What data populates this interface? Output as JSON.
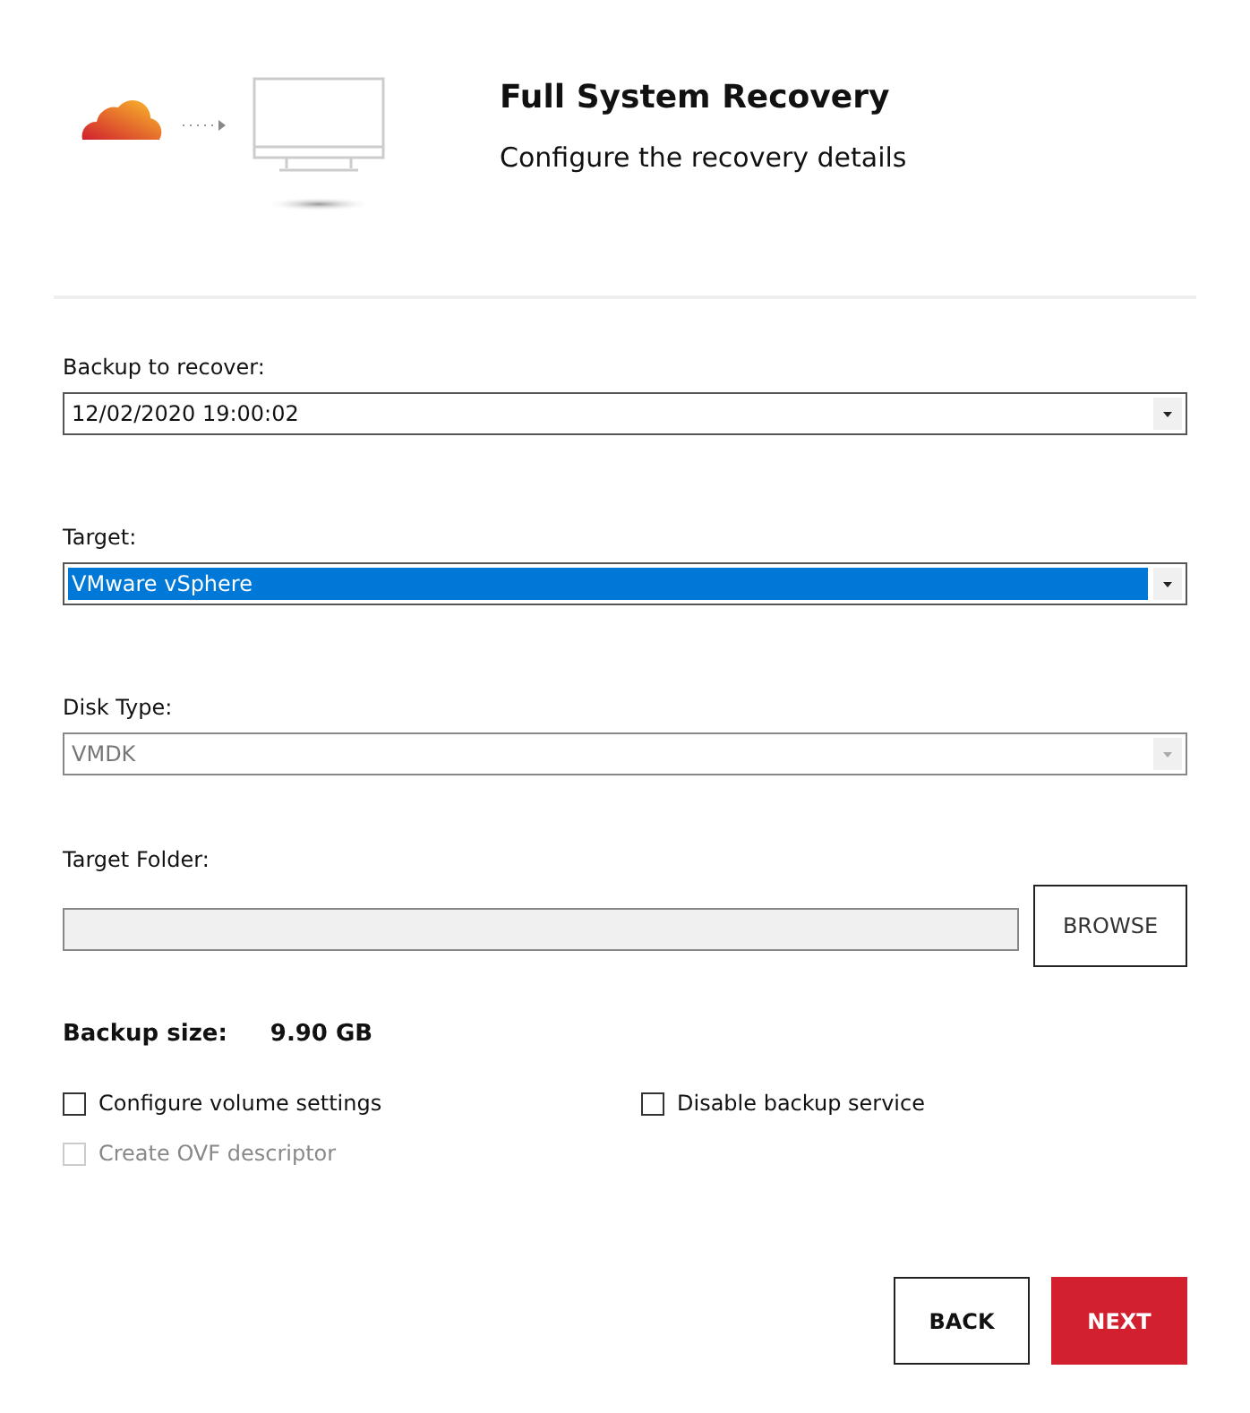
{
  "header": {
    "title": "Full System Recovery",
    "subtitle": "Configure the recovery details"
  },
  "fields": [
    {
      "label": "Backup to recover:",
      "value": "12/02/2020 19:00:02",
      "highlighted": false,
      "disabled": false
    },
    {
      "label": "Target:",
      "value": "VMware vSphere",
      "highlighted": true,
      "disabled": false
    },
    {
      "label": "Disk Type:",
      "value": "VMDK",
      "highlighted": false,
      "disabled": true
    }
  ],
  "target_folder": {
    "label": "Target Folder:",
    "button": "BROWSE"
  },
  "backup_size": {
    "label": "Backup size:",
    "value": "9.90 GB"
  },
  "options": [
    {
      "label": "Configure volume settings",
      "checked": false,
      "disabled": false
    },
    {
      "label": "Disable backup service",
      "checked": false,
      "disabled": false
    },
    {
      "label": "Create OVF descriptor",
      "checked": false,
      "disabled": true
    }
  ],
  "buttons": [
    {
      "label": "BACK",
      "kind": "secondary"
    },
    {
      "label": "NEXT",
      "kind": "primary"
    }
  ]
}
